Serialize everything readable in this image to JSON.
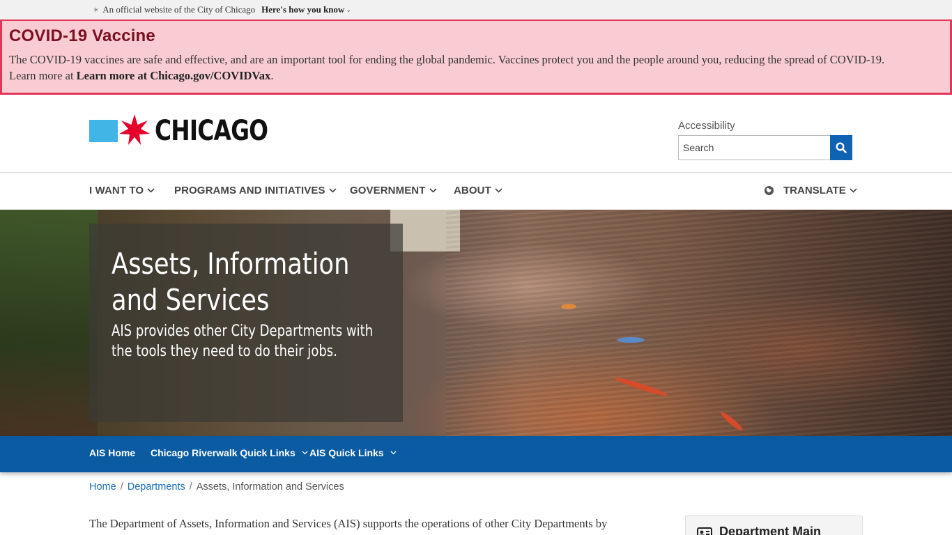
{
  "official_bar": {
    "text": "An official website of the City of Chicago",
    "link": "Here's how you know"
  },
  "alert": {
    "title": "COVID-19 Vaccine",
    "body": "The COVID-19 vaccines are safe and effective, and are an important tool for ending the global pandemic. Vaccines protect you and the people around you, reducing the spread of COVID-19.",
    "learn_prefix": "Learn more at ",
    "learn_link": "Learn more at Chicago.gov/COVIDVax",
    "learn_suffix": "."
  },
  "header": {
    "logo_text": "CHICAGO",
    "accessibility_label": "Accessibility",
    "search_placeholder": "Search"
  },
  "nav": {
    "items": [
      "I WANT TO",
      "PROGRAMS AND INITIATIVES",
      "GOVERNMENT",
      "ABOUT"
    ],
    "translate": "TRANSLATE"
  },
  "hero": {
    "title": "Assets, Information and Services",
    "subtitle": "AIS provides other City Departments with the tools they need to do their jobs."
  },
  "subnav": {
    "items": [
      "AIS Home",
      "Chicago Riverwalk Quick Links",
      "AIS Quick Links"
    ]
  },
  "breadcrumb": {
    "home": "Home",
    "departments": "Departments",
    "current": "Assets, Information and Services"
  },
  "intro": {
    "text": "The Department of Assets, Information and Services (AIS) supports the operations of other City Departments by"
  },
  "sidebar": {
    "card_title": "Department Main"
  },
  "colors": {
    "alert_bg": "#f9ccd3",
    "alert_border": "#e0365a",
    "brand_blue": "#0a5ba2",
    "flag_blue": "#41b6e6",
    "flag_red": "#e4002b"
  }
}
